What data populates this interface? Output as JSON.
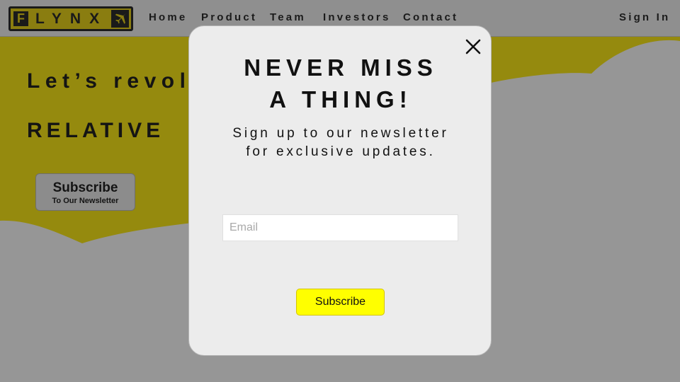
{
  "brand": {
    "logo_initial": "F",
    "logo_text": "LYNX",
    "logo_icon": "airplane-icon",
    "accent_color": "#8a7d10"
  },
  "nav": {
    "items": [
      {
        "label": "Home"
      },
      {
        "label": "Product"
      },
      {
        "label": "Team"
      },
      {
        "label": "Investors"
      },
      {
        "label": "Contact"
      }
    ],
    "sign_in": "Sign In"
  },
  "hero": {
    "line1": "Let’s revol",
    "line2": "RELATIVE",
    "subscribe_main": "Subscribe",
    "subscribe_sub": "To Our Newsletter"
  },
  "modal": {
    "title_line1": "NEVER MISS",
    "title_line2": "A THING!",
    "subtitle_line1": "Sign up to our newsletter",
    "subtitle_line2": "for exclusive updates.",
    "email_placeholder": "Email",
    "email_value": "",
    "subscribe_label": "Subscribe",
    "close_icon": "close-icon",
    "button_color": "#ffff00"
  }
}
